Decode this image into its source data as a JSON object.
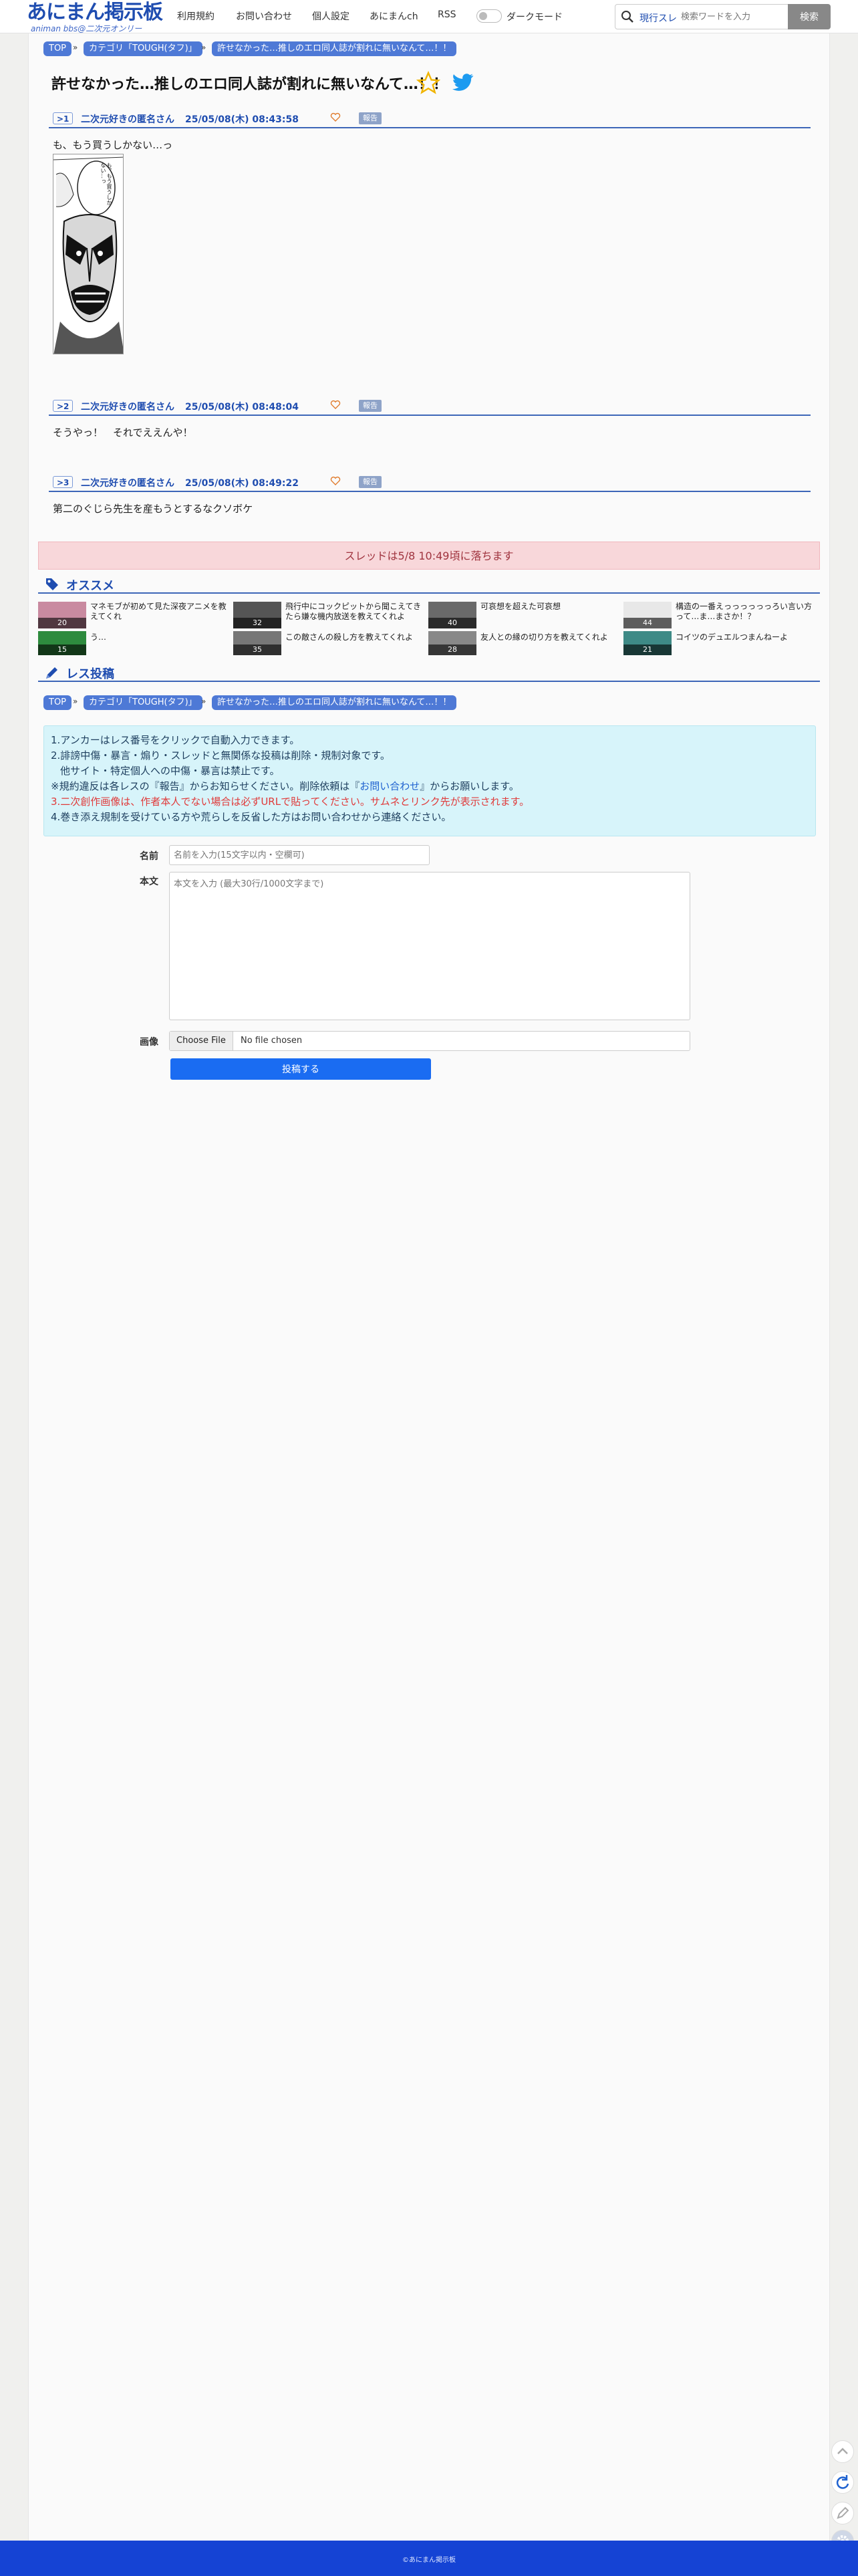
{
  "header": {
    "logo_main": "あにまん掲示板",
    "logo_sub": "animan bbs@二次元オンリー",
    "nav": [
      "利用規約",
      "お問い合わせ",
      "個人設定",
      "あにまんch",
      "RSS"
    ],
    "dark_mode_label": "ダークモード",
    "search_mode": "現行スレ",
    "search_placeholder": "検索ワードを入力",
    "search_button": "検索"
  },
  "breadcrumb": {
    "top": "TOP",
    "category": "カテゴリ「TOUGH(タフ)」",
    "thread": "許せなかった…推しのエロ同人誌が割れに無いなんて…！！"
  },
  "thread": {
    "title": "許せなかった…推しのエロ同人誌が割れに無いなんて…！！"
  },
  "posts": [
    {
      "no": ">1",
      "name": "二次元好きの匿名さん",
      "time": "25/05/08(木) 08:43:58",
      "report": "報告",
      "body": "も、もう買うしかない…っ"
    },
    {
      "no": ">2",
      "name": "二次元好きの匿名さん",
      "time": "25/05/08(木) 08:48:04",
      "report": "報告",
      "body": "そうやっ！　それでええんや！"
    },
    {
      "no": ">3",
      "name": "二次元好きの匿名さん",
      "time": "25/05/08(木) 08:49:22",
      "report": "報告",
      "body": "第二のぐじら先生を産もうとするなクソボケ"
    }
  ],
  "manga_text": "も、もう買うしかない…っ",
  "banner": "スレッドは5/8 10:49頃に落ちます",
  "recommend": {
    "heading": "オススメ",
    "items": [
      {
        "count": "20",
        "title": "マネモブが初めて見た深夜アニメを教えてくれ",
        "count2": "15",
        "title2": "う…"
      },
      {
        "count": "32",
        "title": "飛行中にコックピットから聞こえてきたら嫌な機内放送を教えてくれよ",
        "count2": "35",
        "title2": "この敵さんの殺し方を教えてくれよ"
      },
      {
        "count": "40",
        "title": "可哀想を超えた可哀想",
        "count2": "28",
        "title2": "友人との縁の切り方を教えてくれよ"
      },
      {
        "count": "44",
        "title": "構造の一番えっっっっっっろい言い方って…ま…まさか！？",
        "count2": "21",
        "title2": "コイツのデュエルつまんねーよ"
      }
    ]
  },
  "reply_form": {
    "heading": "レス投稿",
    "rules": [
      "1.アンカーはレス番号をクリックで自動入力できます。",
      "2.誹謗中傷・暴言・煽り・スレッドと無関係な投稿は削除・規制対象です。",
      "他サイト・特定個人への中傷・暴言は禁止です。",
      "※規約違反は各レスの『報告』からお知らせください。削除依頼は『",
      "お問い合わせ",
      "』からお願いします。",
      "3.二次創作画像は、作者本人でない場合は必ずURLで貼ってください。サムネとリンク先が表示されます。",
      "4.巻き添え規制を受けている方や荒らしを反省した方はお問い合わせから連絡ください。"
    ],
    "name_label": "名前",
    "name_placeholder": "名前を入力(15文字以内・空欄可)",
    "body_label": "本文",
    "body_placeholder": "本文を入力 (最大30行/1000文字まで)",
    "image_label": "画像",
    "file_button": "Choose File",
    "file_status": "No file chosen",
    "submit": "投稿する"
  },
  "footer": "©あにまん掲示板",
  "colors": {
    "brand": "#1f4db0",
    "accent": "#1a6cf2",
    "footer": "#1543d4",
    "banner_bg": "#f8d7da"
  }
}
